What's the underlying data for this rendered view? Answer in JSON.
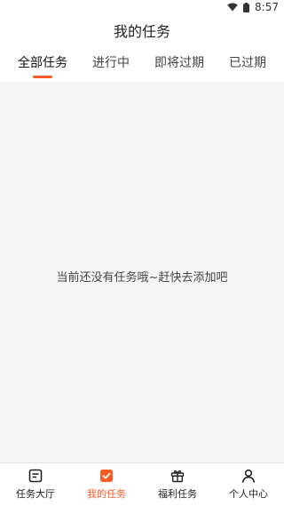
{
  "status_bar": {
    "time": "8:57"
  },
  "header": {
    "title": "我的任务"
  },
  "tabs": [
    {
      "label": "全部任务",
      "active": true
    },
    {
      "label": "进行中",
      "active": false
    },
    {
      "label": "即将过期",
      "active": false
    },
    {
      "label": "已过期",
      "active": false
    }
  ],
  "empty_state": {
    "message": "当前还没有任务哦~赶快去添加吧"
  },
  "bottom_nav": [
    {
      "label": "任务大厅",
      "icon": "task-hall-icon",
      "active": false
    },
    {
      "label": "我的任务",
      "icon": "my-tasks-icon",
      "active": true
    },
    {
      "label": "福利任务",
      "icon": "gift-icon",
      "active": false
    },
    {
      "label": "个人中心",
      "icon": "user-icon",
      "active": false
    }
  ],
  "colors": {
    "accent": "#ff5a24",
    "background": "#f5f5f5"
  }
}
